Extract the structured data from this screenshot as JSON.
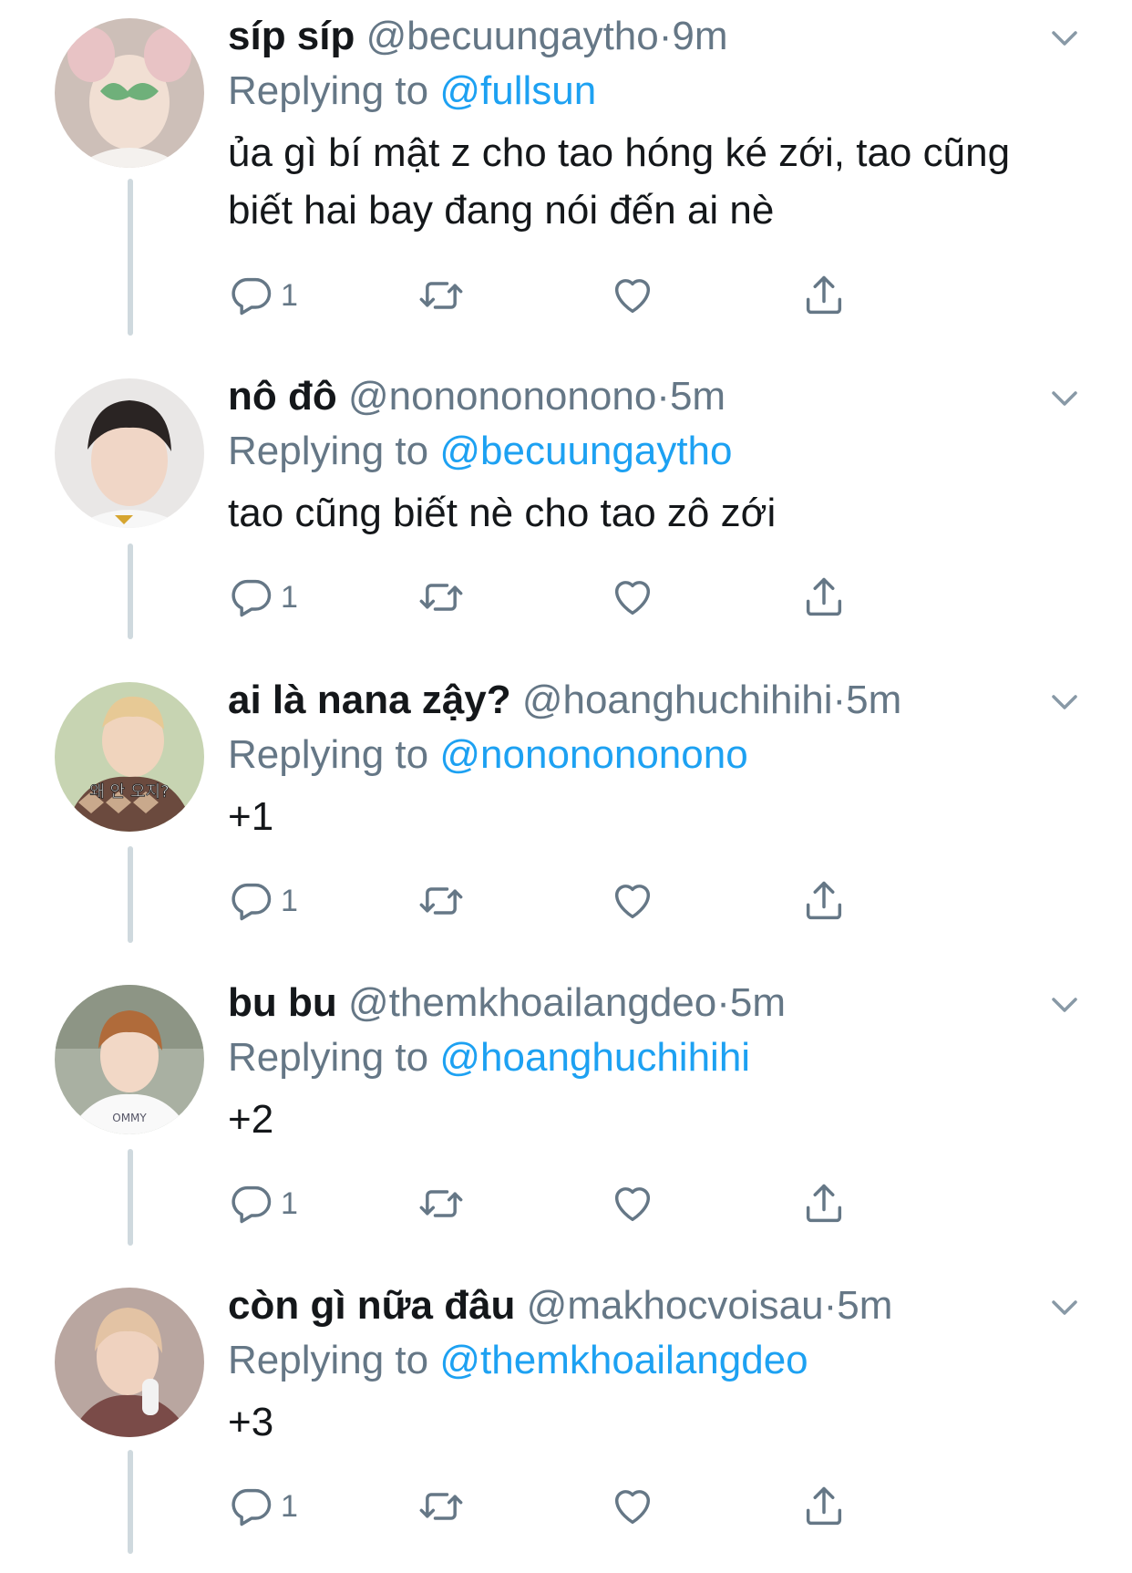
{
  "colors": {
    "link": "#1da1f2",
    "muted": "#657786",
    "text": "#14171a",
    "line": "#cfd9de"
  },
  "icons": {
    "reply": "reply-bubble-icon",
    "retweet": "retweet-icon",
    "like": "heart-icon",
    "share": "share-icon",
    "caret": "chevron-down-icon"
  },
  "tweets": [
    {
      "name": "síp síp",
      "handle": "@becuungaytho",
      "dot": "·",
      "time": "9m",
      "replying_label": "Replying to",
      "replying_to": "@fullsun",
      "text": "ủa gì bí mật z cho tao hóng ké zới, tao cũng biết hai bay đang nói đến ai nè",
      "reply_count": "1"
    },
    {
      "name": "nô đô",
      "handle": "@nononononono",
      "dot": "·",
      "time": "5m",
      "replying_label": "Replying to",
      "replying_to": "@becuungaytho",
      "text": "tao cũng biết nè cho tao zô zới",
      "reply_count": "1"
    },
    {
      "name": "ai là nana zậy?",
      "handle": "@hoanghuchihihi",
      "dot": "·",
      "time": "5m",
      "replying_label": "Replying to",
      "replying_to": "@nononononono",
      "text": "+1",
      "reply_count": "1",
      "avatar_caption": "왜 안 오지?"
    },
    {
      "name": "bu bu",
      "handle": "@themkhoailangdeo",
      "dot": "·",
      "time": "5m",
      "replying_label": "Replying to",
      "replying_to": "@hoanghuchihihi",
      "text": "+2",
      "reply_count": "1",
      "avatar_caption": "OMMY"
    },
    {
      "name": "còn gì nữa đâu",
      "handle": "@makhocvoisau",
      "dot": "·",
      "time": "5m",
      "replying_label": "Replying to",
      "replying_to": "@themkhoailangdeo",
      "text": "+3",
      "reply_count": "1"
    }
  ]
}
